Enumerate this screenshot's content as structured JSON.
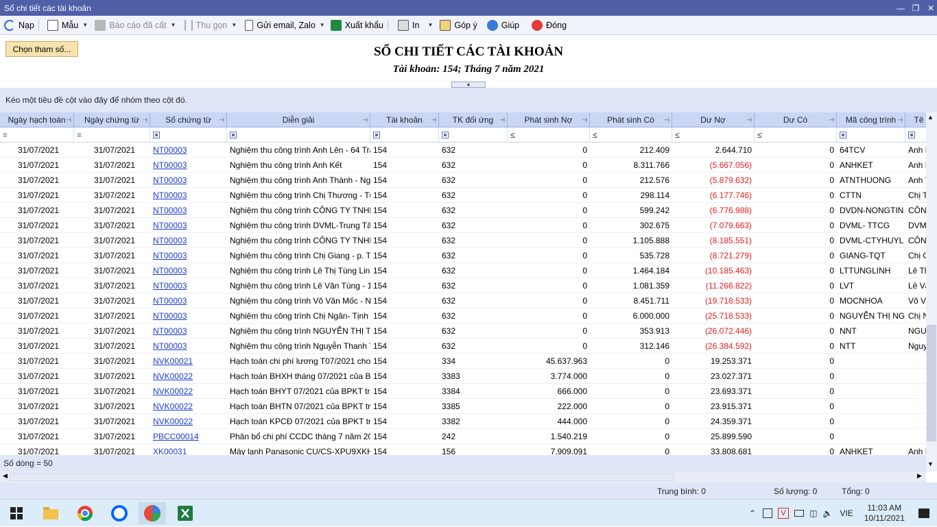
{
  "window": {
    "title": "Sổ chi tiết các tài khoản"
  },
  "toolbar": {
    "refresh": "Nạp",
    "template": "Mẫu",
    "saved_reports": "Báo cáo đã cất",
    "collapse": "Thu gọn",
    "send": "Gửi email, Zalo",
    "export": "Xuất khẩu",
    "print": "In",
    "feedback": "Góp ý",
    "help": "Giúp",
    "close": "Đóng"
  },
  "report": {
    "choose_params": "Chọn tham số...",
    "title": "SỔ CHI TIẾT CÁC TÀI KHOẢN",
    "subtitle": "Tài khoản: 154; Tháng 7 năm 2021"
  },
  "group_panel": "Kéo một tiêu đề cột vào đây để nhóm theo cột đó.",
  "columns": [
    "Ngày hạch toán",
    "Ngày chứng từ",
    "Số chứng từ",
    "Diễn giải",
    "Tài khoản",
    "TK đối ứng",
    "Phát sinh Nợ",
    "Phát sinh Có",
    "Dư Nợ",
    "Dư Có",
    "Mã công trình",
    "Tê"
  ],
  "filters": [
    "=",
    "=",
    "",
    "",
    "",
    "",
    "≤",
    "≤",
    "≤",
    "≤",
    "",
    ""
  ],
  "rows": [
    [
      "31/07/2021",
      "31/07/2021",
      "NT00003",
      "Nghiệm thu công trình Anh Lên - 64 Trã",
      "154",
      "632",
      "0",
      "212.409",
      "2.644.710",
      "0",
      "64TCV",
      "Anh I"
    ],
    [
      "31/07/2021",
      "31/07/2021",
      "NT00003",
      "Nghiệm thu công trình Anh Kết",
      "154",
      "632",
      "0",
      "8.311.766",
      "(5.667.056)",
      "0",
      "ANHKET",
      "Anh I"
    ],
    [
      "31/07/2021",
      "31/07/2021",
      "NT00003",
      "Nghiệm thu công trình Anh Thành - Ngh",
      "154",
      "632",
      "0",
      "212.576",
      "(5.879.632)",
      "0",
      "ATNTHUONG",
      "Anh T"
    ],
    [
      "31/07/2021",
      "31/07/2021",
      "NT00003",
      "Nghiệm thu công trình Chị Thương - Tư",
      "154",
      "632",
      "0",
      "298.114",
      "(6.177.746)",
      "0",
      "CTTN",
      "Chị T"
    ],
    [
      "31/07/2021",
      "31/07/2021",
      "NT00003",
      "Nghiệm thu công trình CÔNG TY TNHH",
      "154",
      "632",
      "0",
      "599.242",
      "(6.776.988)",
      "0",
      "DVDN-NONGTIN",
      "CÔN"
    ],
    [
      "31/07/2021",
      "31/07/2021",
      "NT00003",
      "Nghiệm thu công trình DVML-Trung Tâ",
      "154",
      "632",
      "0",
      "302.675",
      "(7.079.663)",
      "0",
      "DVML- TTCG",
      "DVM"
    ],
    [
      "31/07/2021",
      "31/07/2021",
      "NT00003",
      "Nghiệm thu công trình CÔNG TY TNHH",
      "154",
      "632",
      "0",
      "1.105.888",
      "(8.185.551)",
      "0",
      "DVML-CTYHUYL",
      "CÔN"
    ],
    [
      "31/07/2021",
      "31/07/2021",
      "NT00003",
      "Nghiệm thu công trình Chị Giang - p. Tr",
      "154",
      "632",
      "0",
      "535.728",
      "(8.721.279)",
      "0",
      "GIANG-TQT",
      "Chị G"
    ],
    [
      "31/07/2021",
      "31/07/2021",
      "NT00003",
      "Nghiệm thu công trình Lê Thị Tùng Linh",
      "154",
      "632",
      "0",
      "1.464.184",
      "(10.185.463)",
      "0",
      "LTTUNGLINH",
      "Lê Th"
    ],
    [
      "31/07/2021",
      "31/07/2021",
      "NT00003",
      "Nghiệm thu công trình Lê Văn Tùng - 10",
      "154",
      "632",
      "0",
      "1.081.359",
      "(11.266.822)",
      "0",
      "LVT",
      "Lê Vă"
    ],
    [
      "31/07/2021",
      "31/07/2021",
      "NT00003",
      "Nghiệm thu công trình Võ Văn Mốc - Ng",
      "154",
      "632",
      "0",
      "8.451.711",
      "(19.718.533)",
      "0",
      "MOCNHOA",
      "Võ Vă"
    ],
    [
      "31/07/2021",
      "31/07/2021",
      "NT00003",
      "Nghiệm thu công trình Chị Ngân- Tịnh H",
      "154",
      "632",
      "0",
      "6.000.000",
      "(25.718.533)",
      "0",
      "NGUYỄN THỊ NG",
      "Chị N"
    ],
    [
      "31/07/2021",
      "31/07/2021",
      "NT00003",
      "Nghiệm thu công trình NGUYỄN THỊ T",
      "154",
      "632",
      "0",
      "353.913",
      "(26.072.446)",
      "0",
      "NNT",
      "NGU"
    ],
    [
      "31/07/2021",
      "31/07/2021",
      "NT00003",
      "Nghiệm thu công trình Nguyễn Thanh T",
      "154",
      "632",
      "0",
      "312.146",
      "(26.384.592)",
      "0",
      "NTT",
      "Nguy"
    ],
    [
      "31/07/2021",
      "31/07/2021",
      "NVK00021",
      "Hạch toán chi phí lương T07/2021 cho B",
      "154",
      "334",
      "45.637.963",
      "0",
      "19.253.371",
      "0",
      "",
      ""
    ],
    [
      "31/07/2021",
      "31/07/2021",
      "NVK00022",
      "Hạch toán BHXH tháng 07/2021 của BP",
      "154",
      "3383",
      "3.774.000",
      "0",
      "23.027.371",
      "0",
      "",
      ""
    ],
    [
      "31/07/2021",
      "31/07/2021",
      "NVK00022",
      "Hạch toán BHYT 07/2021 của BPKT tríc",
      "154",
      "3384",
      "666.000",
      "0",
      "23.693.371",
      "0",
      "",
      ""
    ],
    [
      "31/07/2021",
      "31/07/2021",
      "NVK00022",
      "Hạch toán BHTN 07/2021 của BPKT trí",
      "154",
      "3385",
      "222.000",
      "0",
      "23.915.371",
      "0",
      "",
      ""
    ],
    [
      "31/07/2021",
      "31/07/2021",
      "NVK00022",
      "Hạch toán KPCĐ 07/2021 của BPKT trí",
      "154",
      "3382",
      "444.000",
      "0",
      "24.359.371",
      "0",
      "",
      ""
    ],
    [
      "31/07/2021",
      "31/07/2021",
      "PBCC00014",
      "Phân bổ chi phí CCDC tháng 7 năm 202",
      "154",
      "242",
      "1.540.219",
      "0",
      "25.899.590",
      "0",
      "",
      ""
    ],
    [
      "31/07/2021",
      "31/07/2021",
      "XK00031",
      "Máy lạnh Panasonic CU/CS-XPU9XKH-",
      "154",
      "156",
      "7.909.091",
      "0",
      "33.808.681",
      "0",
      "ANHKET",
      "Anh I"
    ]
  ],
  "footer": {
    "row_count": "Số dòng = 50"
  },
  "status": {
    "average": "Trung bình: 0",
    "count": "Số lượng: 0",
    "total": "Tổng: 0"
  },
  "taskbar": {
    "language": "VIE",
    "time": "11:03 AM",
    "date": "10/11/2021"
  },
  "colors": {
    "accent": "#4f5fa8",
    "header_bg": "#c9d6f5",
    "negative": "#e02020",
    "link": "#1a3bd1"
  }
}
